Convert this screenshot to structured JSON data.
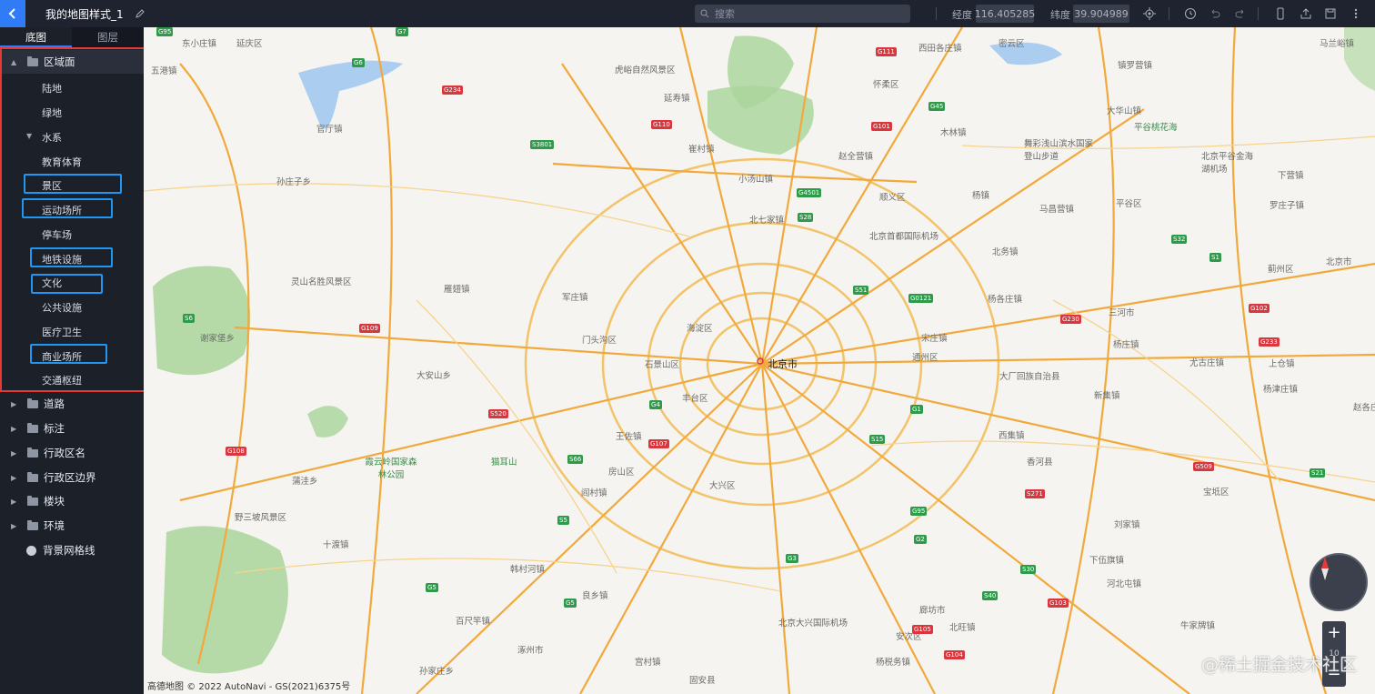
{
  "app": {
    "title": "我的地图样式_1",
    "search_placeholder": "搜索",
    "longitude_label": "经度",
    "longitude_value": "116.405285",
    "latitude_label": "纬度",
    "latitude_value": "39.904989"
  },
  "sidebar": {
    "tabs": [
      "底图",
      "图层"
    ],
    "groups": [
      {
        "label": "区域面",
        "expanded": true
      },
      {
        "label": "道路"
      },
      {
        "label": "标注"
      },
      {
        "label": "行政区名"
      },
      {
        "label": "行政区边界"
      },
      {
        "label": "楼块"
      },
      {
        "label": "环境"
      },
      {
        "label": "背景网格线"
      }
    ],
    "leaves": [
      "陆地",
      "绿地",
      "水系",
      "教育体育",
      "景区",
      "运动场所",
      "停车场",
      "地铁设施",
      "文化",
      "公共设施",
      "医疗卫生",
      "商业场所",
      "交通枢纽"
    ]
  },
  "map": {
    "city": "北京市",
    "places": [
      "东小庄镇",
      "五港镇",
      "孙庄子乡",
      "灵山名胜风景区",
      "雁翅镇",
      "军庄镇",
      "门头沟区",
      "大安山乡",
      "谢家堡乡",
      "石景山区",
      "海淀区",
      "丰台区",
      "王佐镇",
      "房山区",
      "阎村镇",
      "大兴区",
      "霞云岭国家森林公园",
      "猫耳山",
      "蒲洼乡",
      "野三坡风景区",
      "十渡镇",
      "韩村河镇",
      "良乡镇",
      "百尺竿镇",
      "涿州市",
      "孙家庄乡",
      "固安县",
      "宫村镇",
      "北京大兴国际机场",
      "廊坊市",
      "安次区",
      "北旺镇",
      "杨税务镇",
      "虎峪自然风景区",
      "延寿镇",
      "崔村镇",
      "小汤山镇",
      "北七家镇",
      "北京首都国际机场",
      "顺义区",
      "杨镇",
      "马昌营镇",
      "平谷区",
      "北京平谷金海湖机场",
      "舞彩浅山滨水国家登山步道",
      "平谷桃花海",
      "大华山镇",
      "镇罗营镇",
      "蓟州区",
      "三河市",
      "杨庄镇",
      "尤古庄镇",
      "通州区",
      "大厂回族自治县",
      "香河县",
      "新集镇",
      "杨津庄镇",
      "宝坻区",
      "刘家镇",
      "下伍旗镇",
      "河北屯镇",
      "牛家牌镇",
      "西集镇",
      "木林镇",
      "赵全营镇",
      "怀柔区",
      "下营镇",
      "罗庄子镇",
      "马兰峪镇",
      "上仓镇",
      "北京市",
      "北务镇",
      "杨各庄镇",
      "西田各庄镇",
      "密云区",
      "宋庄镇",
      "延庆区",
      "官厅镇",
      "赵各庄镇"
    ],
    "shields_green": [
      "G95",
      "G6",
      "G7",
      "G45",
      "G4501",
      "S3801",
      "S28",
      "S32",
      "S51",
      "G0121",
      "S1",
      "G1",
      "S15",
      "G95",
      "S30",
      "S40",
      "G4",
      "G5",
      "S5",
      "S66",
      "G3",
      "G2",
      "G5",
      "S6",
      "S21"
    ],
    "shields_red": [
      "G234",
      "G111",
      "G110",
      "G101",
      "G230",
      "G102",
      "G109",
      "S520",
      "G108",
      "G107",
      "G233",
      "G105",
      "G104",
      "G103",
      "S271",
      "G509"
    ],
    "attribution": "© 2022 AutoNavi - GS(2021)6375号",
    "brand": "高德地图",
    "zoom_level": "10",
    "watermark": "@稀土掘金技术社区"
  }
}
